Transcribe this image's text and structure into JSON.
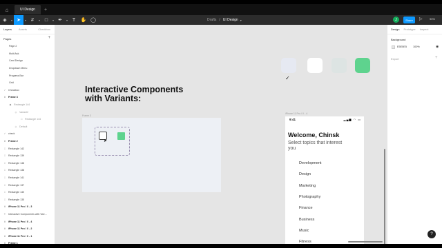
{
  "os_tabs": {
    "file_tab": "UI Design"
  },
  "toolbar": {
    "breadcrumb_drafts": "Drafts",
    "breadcrumb_separator": "/",
    "file_name": "UI Design",
    "avatar_initial": "J",
    "share_label": "Share",
    "zoom_level": "90%"
  },
  "left_panel": {
    "tabs": [
      "Layers",
      "Assets",
      "Checkbox"
    ],
    "pages_title": "Pages",
    "layers": [
      {
        "label": "Page 2",
        "glyph": "",
        "indent": 13,
        "style": "page"
      },
      {
        "label": "Multi Ask",
        "glyph": "",
        "indent": 13,
        "style": "page"
      },
      {
        "label": "Card Design",
        "glyph": "",
        "indent": 13,
        "style": "page"
      },
      {
        "label": "Dropdown Menu",
        "glyph": "",
        "indent": 13,
        "style": "page"
      },
      {
        "label": "Progress Bar",
        "glyph": "",
        "indent": 13,
        "style": "page"
      },
      {
        "label": "Grid",
        "glyph": "",
        "indent": 13,
        "style": "page"
      },
      {
        "label": "Checkbox",
        "glyph": "✓",
        "indent": 4,
        "style": "normal"
      },
      {
        "label": "Frame 3",
        "glyph": "#",
        "indent": 4,
        "style": "bold"
      },
      {
        "label": "Rectangle 144",
        "glyph": "◆",
        "indent": 12,
        "style": "faded"
      },
      {
        "label": "Variant2",
        "glyph": "◇",
        "indent": 20,
        "style": "faded"
      },
      {
        "label": "Rectangle 144",
        "glyph": "□",
        "indent": 28,
        "style": "faded"
      },
      {
        "label": "Default",
        "glyph": "◇",
        "indent": 20,
        "style": "faded"
      },
      {
        "label": "check",
        "glyph": "✓",
        "indent": 4,
        "style": "normal"
      },
      {
        "label": "Frame 2",
        "glyph": "#",
        "indent": 4,
        "style": "bold"
      },
      {
        "label": "Rectangle 142",
        "glyph": "□",
        "indent": 4,
        "style": "normal"
      },
      {
        "label": "Rectangle 139",
        "glyph": "□",
        "indent": 4,
        "style": "normal"
      },
      {
        "label": "Rectangle 148",
        "glyph": "□",
        "indent": 4,
        "style": "normal"
      },
      {
        "label": "Rectangle 138",
        "glyph": "□",
        "indent": 4,
        "style": "normal"
      },
      {
        "label": "Rectangle 141",
        "glyph": "□",
        "indent": 4,
        "style": "normal"
      },
      {
        "label": "Rectangle 137",
        "glyph": "□",
        "indent": 4,
        "style": "normal"
      },
      {
        "label": "Rectangle 140",
        "glyph": "□",
        "indent": 4,
        "style": "normal"
      },
      {
        "label": "Rectangle 135",
        "glyph": "□",
        "indent": 4,
        "style": "normal"
      },
      {
        "label": "iPhone 11 Pro / X - 3",
        "glyph": "#",
        "indent": 4,
        "style": "bold"
      },
      {
        "label": "Interactive Components with Vari…",
        "glyph": "T",
        "indent": 4,
        "style": "normal"
      },
      {
        "label": "iPhone 11 Pro / X - 4",
        "glyph": "#",
        "indent": 4,
        "style": "bold"
      },
      {
        "label": "iPhone 11 Pro / X - 2",
        "glyph": "#",
        "indent": 4,
        "style": "bold"
      },
      {
        "label": "iPhone 11 Pro / X - 1",
        "glyph": "#",
        "indent": 4,
        "style": "bold"
      },
      {
        "label": "Frame 1",
        "glyph": "#",
        "indent": 4,
        "style": "bold"
      }
    ]
  },
  "canvas": {
    "swatches": [
      {
        "color": "#e6e9f2"
      },
      {
        "color": "#ffffff"
      },
      {
        "color": "#dde4e3"
      },
      {
        "color": "#5ed38e"
      }
    ],
    "heading": "Interactive Components\nwith Variants:",
    "frame3_label": "Frame 3",
    "phone_label": "iPhone 11 Pro / X - 4",
    "phone": {
      "time": "9:41",
      "welcome": "Welcome, Chinsk",
      "subtitle": "Select topics that interest you",
      "topics": [
        "Development",
        "Design",
        "Marketing",
        "Photography",
        "Finance",
        "Business",
        "Music",
        "Fitness"
      ]
    }
  },
  "right_panel": {
    "tabs": [
      "Design",
      "Prototype",
      "Inspect"
    ],
    "background_title": "Background",
    "bg_hex": "E5E5E5",
    "bg_opacity": "100%",
    "export_label": "Export"
  },
  "help_label": "?"
}
